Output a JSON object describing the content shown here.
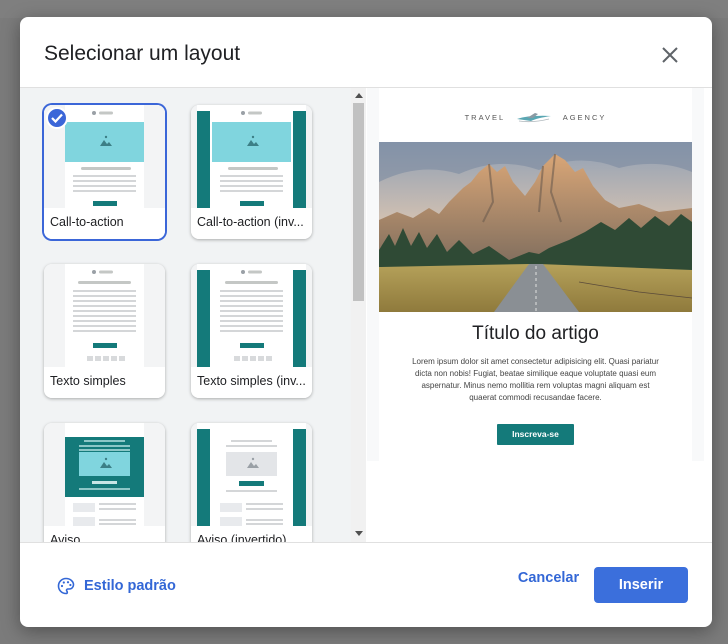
{
  "dialog": {
    "title": "Selecionar um layout",
    "close_icon": "close-icon"
  },
  "layouts": [
    {
      "label": "Call-to-action",
      "selected": true
    },
    {
      "label": "Call-to-action (inv...",
      "selected": false
    },
    {
      "label": "Texto simples",
      "selected": false
    },
    {
      "label": "Texto simples (inv...",
      "selected": false
    },
    {
      "label": "Aviso",
      "selected": false
    },
    {
      "label": "Aviso (invertido)",
      "selected": false
    }
  ],
  "preview": {
    "brand_left": "TRAVEL",
    "brand_right": "AGENCY",
    "article_title": "Título do artigo",
    "article_body": "Lorem ipsum dolor sit amet consectetur adipisicing elit. Quasi pariatur dicta non nobis! Fugiat, beatae similique eaque voluptate quasi eum aspernatur. Minus nemo mollitia rem voluptas magni aliquam est quaerat commodi recusandae facere.",
    "cta_label": "Inscreva-se"
  },
  "footer": {
    "style_label": "Estilo padrão",
    "style_icon": "palette-icon",
    "cancel_label": "Cancelar",
    "insert_label": "Inserir"
  },
  "colors": {
    "accent": "#3b6fdc",
    "teal": "#147a7a",
    "light_teal": "#7fd3dc"
  }
}
